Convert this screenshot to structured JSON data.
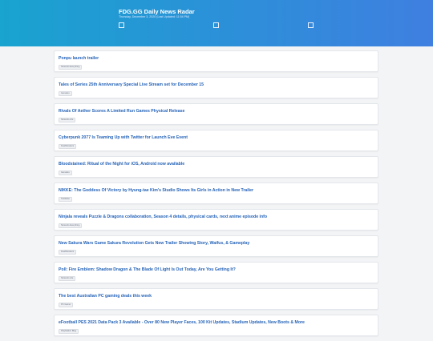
{
  "header": {
    "title": "FDG.GG Daily News Radar",
    "subtitle": "Thursday, December 3, 2020 (Last Updated: 11:54 PM)"
  },
  "articles": [
    {
      "title": "Ponpu launch trailer",
      "source": "Nintendo Everything"
    },
    {
      "title": "Tales of Series 25th Anniversary Special Live Stream set for December 15",
      "source": "Gematsu"
    },
    {
      "title": "Rivals Of Aether Scores A Limited Run Games Physical Release",
      "source": "Nintendo Life"
    },
    {
      "title": "Cyberpunk 2077 Is Teaming Up with Twitter for Launch Eve Event",
      "source": "DualShockers"
    },
    {
      "title": "Bloodstained: Ritual of the Night for iOS, Android now available",
      "source": "Gematsu"
    },
    {
      "title": "NIKKE: The Goddess Of Victory by Hyung-tae Kim's Studio Shows Its Girls in Action in New Trailer",
      "source": "Twinfinite"
    },
    {
      "title": "Ninjala reveals Puzzle & Dragons collaboration, Season 4 details, physical cards, next anime episode info",
      "source": "Nintendo Everything"
    },
    {
      "title": "New Sakura Wars Game Sakura Revolution Gets New Trailer Showing Story, Waifus, & Gameplay",
      "source": "DualShockers"
    },
    {
      "title": "Poll: Fire Emblem: Shadow Dragon & The Blade Of Light Is Out Today, Are You Getting It?",
      "source": "Nintendo Life"
    },
    {
      "title": "The best Australian PC gaming deals this week",
      "source": "PC Gamer"
    },
    {
      "title": "eFootball PES 2021 Data Pack 3 Available - Over 80 New Player Faces, 100 Kit Updates, Stadium Updates, New Boots & More",
      "source": "PlayStation Blog"
    }
  ]
}
